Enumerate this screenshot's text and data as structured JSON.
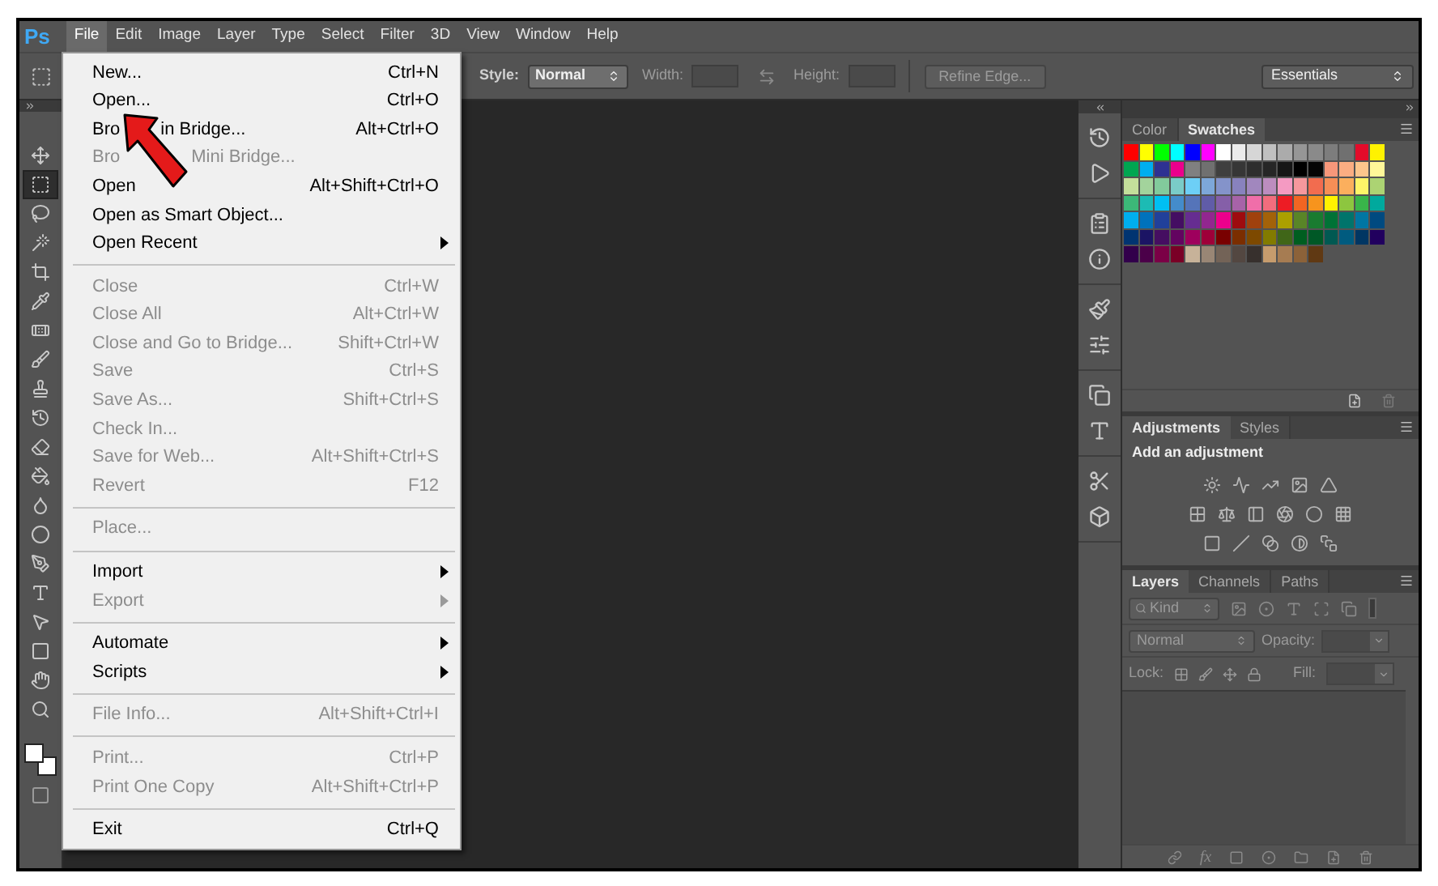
{
  "app": {
    "logo": "Ps"
  },
  "menubar": [
    {
      "label": "File",
      "selected": true
    },
    {
      "label": "Edit",
      "selected": false
    },
    {
      "label": "Image",
      "selected": false
    },
    {
      "label": "Layer",
      "selected": false
    },
    {
      "label": "Type",
      "selected": false
    },
    {
      "label": "Select",
      "selected": false
    },
    {
      "label": "Filter",
      "selected": false
    },
    {
      "label": "3D",
      "selected": false
    },
    {
      "label": "View",
      "selected": false
    },
    {
      "label": "Window",
      "selected": false
    },
    {
      "label": "Help",
      "selected": false
    }
  ],
  "options_bar": {
    "style_label": "Style:",
    "style_value": "Normal",
    "width_label": "Width:",
    "height_label": "Height:",
    "refine_edge": "Refine Edge...",
    "workspace": "Essentials"
  },
  "tools": [
    {
      "selected": false
    },
    {
      "selected": true
    },
    {
      "selected": false
    },
    {
      "selected": false
    },
    {
      "selected": false
    },
    {
      "selected": false
    },
    {
      "selected": false
    },
    {
      "selected": false
    },
    {
      "selected": false
    },
    {
      "selected": false
    },
    {
      "selected": false
    },
    {
      "selected": false
    },
    {
      "selected": false
    },
    {
      "selected": false
    },
    {
      "selected": false
    },
    {
      "selected": false
    },
    {
      "selected": false
    },
    {
      "selected": false
    },
    {
      "selected": false
    },
    {
      "selected": false
    }
  ],
  "file_menu": {
    "items": [
      {
        "kind": "item",
        "label": "New...",
        "shortcut": "Ctrl+N",
        "disabled": false,
        "submenu": false
      },
      {
        "kind": "item",
        "label": "Open...",
        "shortcut": "Ctrl+O",
        "disabled": false,
        "submenu": false
      },
      {
        "kind": "item",
        "label": "Bro",
        "label_after": "in Bridge...",
        "shortcut": "Alt+Ctrl+O",
        "disabled": false,
        "submenu": false
      },
      {
        "kind": "item",
        "label": "Bro",
        "label_after": "Mini Bridge...",
        "disabled": true,
        "submenu": false
      },
      {
        "kind": "item",
        "label": "Open",
        "shortcut": "Alt+Shift+Ctrl+O",
        "disabled": false,
        "submenu": false
      },
      {
        "kind": "item",
        "label": "Open as Smart Object...",
        "disabled": false,
        "submenu": false
      },
      {
        "kind": "item",
        "label": "Open Recent",
        "disabled": false,
        "submenu": true
      },
      {
        "kind": "separator"
      },
      {
        "kind": "item",
        "label": "Close",
        "shortcut": "Ctrl+W",
        "disabled": true,
        "submenu": false
      },
      {
        "kind": "item",
        "label": "Close All",
        "shortcut": "Alt+Ctrl+W",
        "disabled": true,
        "submenu": false
      },
      {
        "kind": "item",
        "label": "Close and Go to Bridge...",
        "shortcut": "Shift+Ctrl+W",
        "disabled": true,
        "submenu": false
      },
      {
        "kind": "item",
        "label": "Save",
        "shortcut": "Ctrl+S",
        "disabled": true,
        "submenu": false
      },
      {
        "kind": "item",
        "label": "Save As...",
        "shortcut": "Shift+Ctrl+S",
        "disabled": true,
        "submenu": false
      },
      {
        "kind": "item",
        "label": "Check In...",
        "disabled": true,
        "submenu": false
      },
      {
        "kind": "item",
        "label": "Save for Web...",
        "shortcut": "Alt+Shift+Ctrl+S",
        "disabled": true,
        "submenu": false
      },
      {
        "kind": "item",
        "label": "Revert",
        "shortcut": "F12",
        "disabled": true,
        "submenu": false
      },
      {
        "kind": "separator"
      },
      {
        "kind": "item",
        "label": "Place...",
        "disabled": true,
        "submenu": false
      },
      {
        "kind": "separator"
      },
      {
        "kind": "item",
        "label": "Import",
        "disabled": false,
        "submenu": true
      },
      {
        "kind": "item",
        "label": "Export",
        "disabled": true,
        "submenu": true
      },
      {
        "kind": "separator"
      },
      {
        "kind": "item",
        "label": "Automate",
        "disabled": false,
        "submenu": true
      },
      {
        "kind": "item",
        "label": "Scripts",
        "disabled": false,
        "submenu": true
      },
      {
        "kind": "separator"
      },
      {
        "kind": "item",
        "label": "File Info...",
        "shortcut": "Alt+Shift+Ctrl+I",
        "disabled": true,
        "submenu": false
      },
      {
        "kind": "separator"
      },
      {
        "kind": "item",
        "label": "Print...",
        "shortcut": "Ctrl+P",
        "disabled": true,
        "submenu": false
      },
      {
        "kind": "item",
        "label": "Print One Copy",
        "shortcut": "Alt+Shift+Ctrl+P",
        "disabled": true,
        "submenu": false
      },
      {
        "kind": "separator"
      },
      {
        "kind": "item",
        "label": "Exit",
        "shortcut": "Ctrl+Q",
        "disabled": false,
        "submenu": false
      }
    ]
  },
  "swatches_panel": {
    "tabs": [
      {
        "label": "Color",
        "selected": false
      },
      {
        "label": "Swatches",
        "selected": true
      }
    ],
    "rows": [
      {
        "swatches": [
          {
            "color": "#ff0000"
          },
          {
            "color": "#ffff00"
          },
          {
            "color": "#00ff00"
          },
          {
            "color": "#00ffff"
          },
          {
            "color": "#0000ff"
          },
          {
            "color": "#ff00ff"
          },
          {
            "color": "#ffffff"
          },
          {
            "color": "#ebebeb"
          },
          {
            "color": "#d6d6d6"
          },
          {
            "color": "#c0c0c0"
          },
          {
            "color": "#ababab"
          },
          {
            "color": "#969696"
          },
          {
            "color": "#8a8a8a"
          },
          {
            "color": "#7d7d7d"
          },
          {
            "color": "#707070"
          },
          {
            "color": "#e30b2a"
          },
          {
            "color": "#fff200"
          }
        ]
      },
      {
        "swatches": [
          {
            "color": "#00a651"
          },
          {
            "color": "#00aeef"
          },
          {
            "color": "#2e3192"
          },
          {
            "color": "#ec008c"
          },
          {
            "color": "#808080"
          },
          {
            "color": "#707070"
          },
          {
            "color": "#3f3f3f"
          },
          {
            "color": "#363636"
          },
          {
            "color": "#2e2e2e"
          },
          {
            "color": "#262626"
          },
          {
            "color": "#161616"
          },
          {
            "color": "#000000"
          },
          {
            "color": "#050505"
          },
          {
            "color": "#f7977a"
          },
          {
            "color": "#fbad82"
          },
          {
            "color": "#fdc68c"
          },
          {
            "color": "#fff799"
          }
        ]
      },
      {
        "swatches": [
          {
            "color": "#c4df9b"
          },
          {
            "color": "#a3d39c"
          },
          {
            "color": "#82ca9c"
          },
          {
            "color": "#7accc8"
          },
          {
            "color": "#6dcff6"
          },
          {
            "color": "#7da7d9"
          },
          {
            "color": "#8493ca"
          },
          {
            "color": "#8882be"
          },
          {
            "color": "#a187be"
          },
          {
            "color": "#bc8dbf"
          },
          {
            "color": "#f49ac2"
          },
          {
            "color": "#f6989d"
          },
          {
            "color": "#f26c4f"
          },
          {
            "color": "#f68e56"
          },
          {
            "color": "#fbaf5d"
          },
          {
            "color": "#fff568"
          },
          {
            "color": "#acd373"
          }
        ]
      },
      {
        "swatches": [
          {
            "color": "#3cb878"
          },
          {
            "color": "#1cbbb4"
          },
          {
            "color": "#00bff3"
          },
          {
            "color": "#448ccb"
          },
          {
            "color": "#5574b9"
          },
          {
            "color": "#605ca8"
          },
          {
            "color": "#855fa8"
          },
          {
            "color": "#a763a8"
          },
          {
            "color": "#f06ea9"
          },
          {
            "color": "#f26d7d"
          },
          {
            "color": "#ed1c24"
          },
          {
            "color": "#f26522"
          },
          {
            "color": "#f7941d"
          },
          {
            "color": "#fff200"
          },
          {
            "color": "#8dc63f"
          },
          {
            "color": "#39b54a"
          },
          {
            "color": "#00a99d"
          }
        ]
      },
      {
        "swatches": [
          {
            "color": "#00aeef"
          },
          {
            "color": "#0072bc"
          },
          {
            "color": "#21409a"
          },
          {
            "color": "#440e62"
          },
          {
            "color": "#662d91"
          },
          {
            "color": "#92278f"
          },
          {
            "color": "#ec008c"
          },
          {
            "color": "#9e0b0f"
          },
          {
            "color": "#a0410d"
          },
          {
            "color": "#a36209"
          },
          {
            "color": "#aba000"
          },
          {
            "color": "#598527"
          },
          {
            "color": "#197b30"
          },
          {
            "color": "#007236"
          },
          {
            "color": "#00746b"
          },
          {
            "color": "#0076a3"
          },
          {
            "color": "#004a80"
          }
        ]
      },
      {
        "swatches": [
          {
            "color": "#003471"
          },
          {
            "color": "#1b1464"
          },
          {
            "color": "#450e61"
          },
          {
            "color": "#630460"
          },
          {
            "color": "#9e005d"
          },
          {
            "color": "#9e0039"
          },
          {
            "color": "#790000"
          },
          {
            "color": "#7b2e00"
          },
          {
            "color": "#7d4900"
          },
          {
            "color": "#827b00"
          },
          {
            "color": "#406618"
          },
          {
            "color": "#005e20"
          },
          {
            "color": "#005826"
          },
          {
            "color": "#005952"
          },
          {
            "color": "#005b7f"
          },
          {
            "color": "#003663"
          },
          {
            "color": "#21005e"
          }
        ]
      },
      {
        "swatches": [
          {
            "color": "#32004b"
          },
          {
            "color": "#4b0049"
          },
          {
            "color": "#7b0046"
          },
          {
            "color": "#7a0026"
          },
          {
            "color": "#c7b299"
          },
          {
            "color": "#998675"
          },
          {
            "color": "#736357"
          },
          {
            "color": "#534741"
          },
          {
            "color": "#37302d"
          },
          {
            "color": "#c69c6d"
          },
          {
            "color": "#a67c52"
          },
          {
            "color": "#8c6239"
          },
          {
            "color": "#603913"
          }
        ]
      }
    ]
  },
  "adjustments_panel": {
    "tabs": [
      {
        "label": "Adjustments",
        "selected": true
      },
      {
        "label": "Styles",
        "selected": false
      }
    ],
    "heading": "Add an adjustment"
  },
  "layers_panel": {
    "tabs": [
      {
        "label": "Layers",
        "selected": true
      },
      {
        "label": "Channels",
        "selected": false
      },
      {
        "label": "Paths",
        "selected": false
      }
    ],
    "kind": "Kind",
    "blend_mode": "Normal",
    "opacity_label": "Opacity:",
    "lock_label": "Lock:",
    "fill_label": "Fill:",
    "fx": "fx"
  }
}
